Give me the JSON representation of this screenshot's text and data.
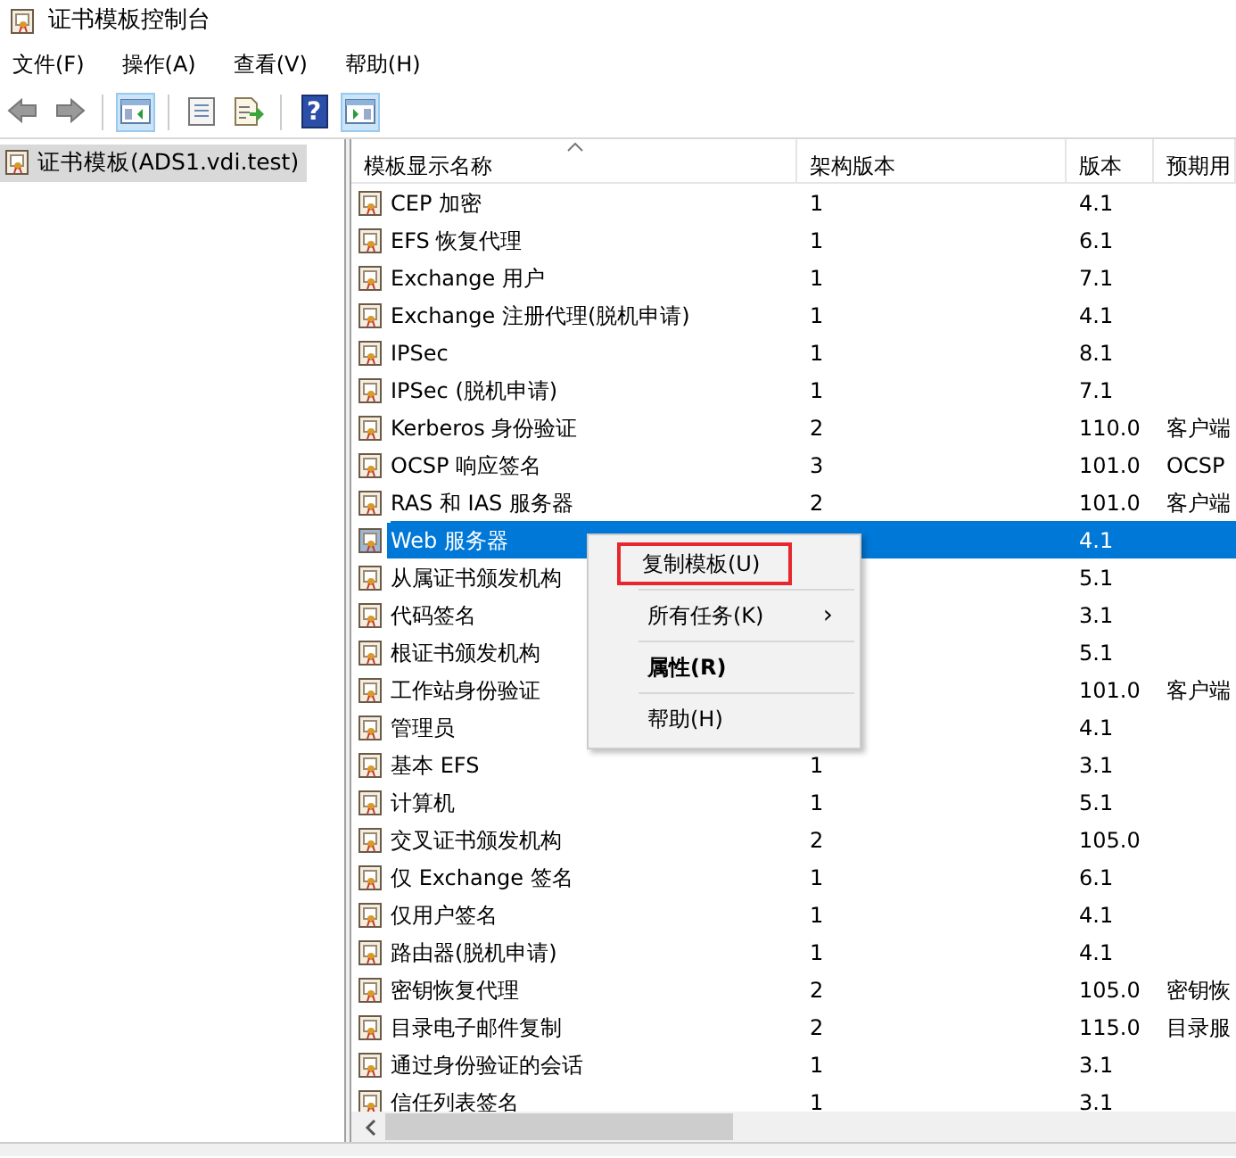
{
  "window": {
    "title": "证书模板控制台"
  },
  "menu_bar": [
    "文件(F)",
    "操作(A)",
    "查看(V)",
    "帮助(H)"
  ],
  "toolbar": [
    {
      "kind": "back"
    },
    {
      "kind": "forward"
    },
    {
      "kind": "sep"
    },
    {
      "kind": "tree",
      "pressed": true
    },
    {
      "kind": "sep"
    },
    {
      "kind": "properties"
    },
    {
      "kind": "export"
    },
    {
      "kind": "sep"
    },
    {
      "kind": "help",
      "glyph": "?"
    },
    {
      "kind": "pane",
      "pressed": true
    }
  ],
  "tree": [
    {
      "label": "证书模板(ADS1.vdi.test)",
      "selected": true
    }
  ],
  "table": {
    "columns": [
      "模板显示名称",
      "架构版本",
      "版本",
      "预期用"
    ],
    "rows": [
      {
        "name": "CEP 加密",
        "schema": "1",
        "version": "4.1",
        "selected": false
      },
      {
        "name": "EFS 恢复代理",
        "schema": "1",
        "version": "6.1",
        "selected": false
      },
      {
        "name": "Exchange 用户",
        "schema": "1",
        "version": "7.1",
        "selected": false
      },
      {
        "name": "Exchange 注册代理(脱机申请)",
        "schema": "1",
        "version": "4.1",
        "selected": false
      },
      {
        "name": "IPSec",
        "schema": "1",
        "version": "8.1",
        "selected": false
      },
      {
        "name": "IPSec (脱机申请)",
        "schema": "1",
        "version": "7.1",
        "selected": false
      },
      {
        "name": "Kerberos 身份验证",
        "schema": "2",
        "version": "110.0",
        "purpose": "客户端",
        "selected": false
      },
      {
        "name": "OCSP 响应签名",
        "schema": "3",
        "version": "101.0",
        "purpose": "OCSP",
        "selected": false
      },
      {
        "name": "RAS 和 IAS 服务器",
        "schema": "2",
        "version": "101.0",
        "purpose": "客户端",
        "selected": false
      },
      {
        "name": "Web 服务器",
        "version": "4.1",
        "selected": true
      },
      {
        "name": "从属证书颁发机构",
        "version": "5.1",
        "selected": false
      },
      {
        "name": "代码签名",
        "version": "3.1",
        "selected": false
      },
      {
        "name": "根证书颁发机构",
        "version": "5.1",
        "selected": false
      },
      {
        "name": "工作站身份验证",
        "version": "101.0",
        "purpose": "客户端",
        "selected": false
      },
      {
        "name": "管理员",
        "version": "4.1",
        "selected": false
      },
      {
        "name": "基本 EFS",
        "schema": "1",
        "version": "3.1",
        "selected": false
      },
      {
        "name": "计算机",
        "schema": "1",
        "version": "5.1",
        "selected": false
      },
      {
        "name": "交叉证书颁发机构",
        "schema": "2",
        "version": "105.0",
        "selected": false
      },
      {
        "name": "仅 Exchange 签名",
        "schema": "1",
        "version": "6.1",
        "selected": false
      },
      {
        "name": "仅用户签名",
        "schema": "1",
        "version": "4.1",
        "selected": false
      },
      {
        "name": "路由器(脱机申请)",
        "schema": "1",
        "version": "4.1",
        "selected": false
      },
      {
        "name": "密钥恢复代理",
        "schema": "2",
        "version": "105.0",
        "purpose": "密钥恢",
        "selected": false
      },
      {
        "name": "目录电子邮件复制",
        "schema": "2",
        "version": "115.0",
        "purpose": "目录服",
        "selected": false
      },
      {
        "name": "通过身份验证的会话",
        "schema": "1",
        "version": "3.1",
        "selected": false
      },
      {
        "name": "信任列表签名",
        "schema": "1",
        "version": "3.1",
        "selected": false
      }
    ]
  },
  "context_menu": [
    {
      "label": "复制模板(U)",
      "kind": "item",
      "outlined": true,
      "bold": false
    },
    {
      "label": "所有任务(K)",
      "kind": "submenu",
      "submenu_arrow": "›",
      "outlined": false,
      "bold": false
    },
    {
      "label": "属性(R)",
      "kind": "item",
      "outlined": false,
      "bold": true
    },
    {
      "label": "帮助(H)",
      "kind": "item",
      "outlined": false,
      "bold": false
    }
  ]
}
